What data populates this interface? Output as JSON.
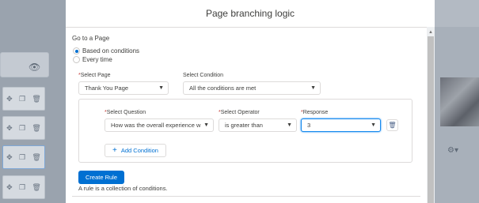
{
  "modal": {
    "title": "Page branching logic",
    "section_title": "Go to a Page",
    "options": [
      {
        "label": "Based on conditions",
        "selected": true
      },
      {
        "label": "Every time",
        "selected": false
      }
    ],
    "select_page": {
      "label": "Select Page",
      "value": "Thank You Page",
      "required": true
    },
    "select_condition": {
      "label": "Select Condition",
      "value": "All the conditions are met"
    },
    "rule": {
      "question": {
        "label": "Select Question",
        "value": "How was the overall experience w"
      },
      "operator": {
        "label": "Select Operator",
        "value": "is greater than"
      },
      "response": {
        "label": "Response",
        "value": "3"
      }
    },
    "add_condition_label": "Add Condition",
    "create_rule_label": "Create Rule",
    "helper_text": "A rule is a collection of conditions.",
    "required_mark": "*"
  },
  "colors": {
    "brand": "#0070d2",
    "required": "#c23934",
    "text": "#3e3e3c"
  },
  "icons": [
    "eye-icon",
    "move-icon",
    "copy-icon",
    "trash-icon",
    "chevron-down-icon",
    "plus-icon",
    "gear-icon"
  ]
}
